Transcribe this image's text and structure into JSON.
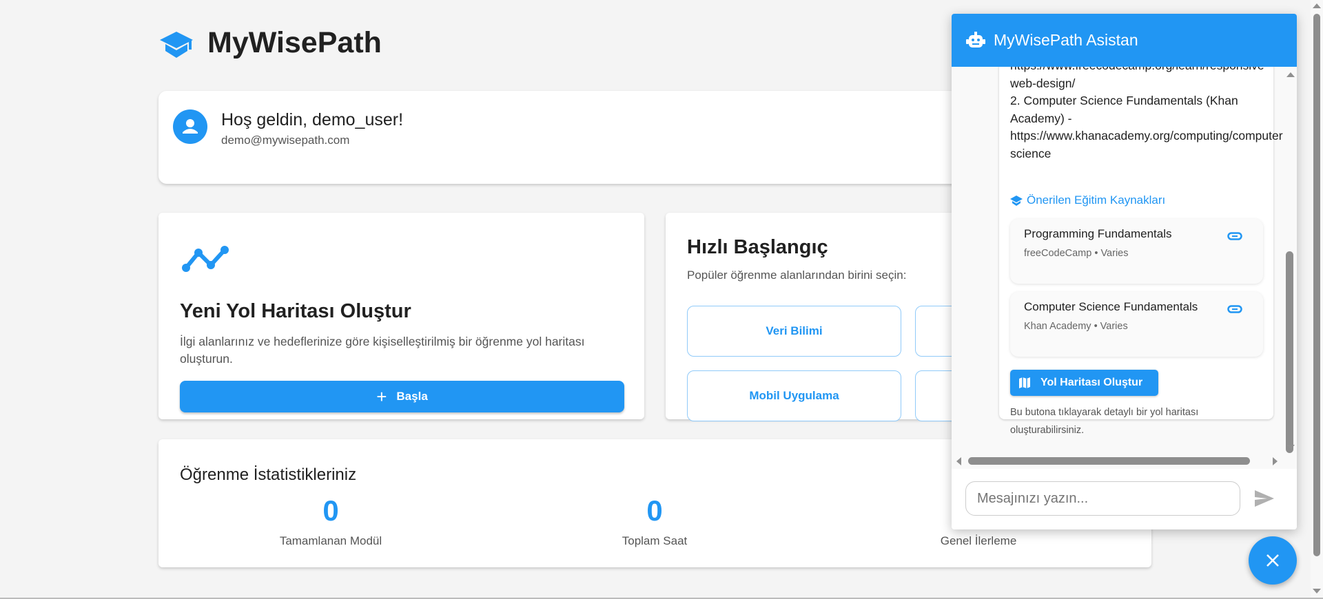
{
  "app": {
    "title": "MyWisePath",
    "logo_icon": "graduation-cap-icon"
  },
  "welcome": {
    "greeting": "Hoş geldin, demo_user!",
    "email": "demo@mywisepath.com"
  },
  "new_roadmap": {
    "title": "Yeni Yol Haritası Oluştur",
    "description_line1": "İlgi alanlarınız ve hedeflerinize göre kişiselleştirilmiş bir öğrenme yol haritası",
    "description_line2": "oluşturun.",
    "button": "Başla"
  },
  "quick_start": {
    "title": "Hızlı Başlangıç",
    "subtitle": "Popüler öğrenme alanlarından birini seçin:",
    "options": [
      "Veri Bilimi",
      "Mobil Uygulama"
    ]
  },
  "stats": {
    "title": "Öğrenme İstatistikleriniz",
    "items": [
      {
        "value": "0",
        "label": "Tamamlanan Modül"
      },
      {
        "value": "0",
        "label": "Toplam Saat"
      },
      {
        "value": "",
        "label": "Genel İlerleme"
      }
    ]
  },
  "chat": {
    "title": "MyWisePath Asistan",
    "message_lines": [
      "https://www.freecodecamp.org/learn/responsive-",
      "web-design/",
      "2. Computer Science Fundamentals (Khan",
      "Academy) -",
      "https://www.khanacademy.org/computing/computer-",
      "science"
    ],
    "resources_heading": "Önerilen Eğitim Kaynakları",
    "resources": [
      {
        "title": "Programming Fundamentals",
        "meta": "freeCodeCamp • Varies"
      },
      {
        "title": "Computer Science Fundamentals",
        "meta": "Khan Academy • Varies"
      }
    ],
    "roadmap_button": "Yol Haritası Oluştur",
    "note_line1": "Bu butona tıklayarak detaylı bir yol haritası",
    "note_line2": "oluşturabilirsiniz.",
    "input_placeholder": "Mesajınızı yazın..."
  },
  "colors": {
    "accent": "#2196F3",
    "background": "#f4f4f4"
  }
}
